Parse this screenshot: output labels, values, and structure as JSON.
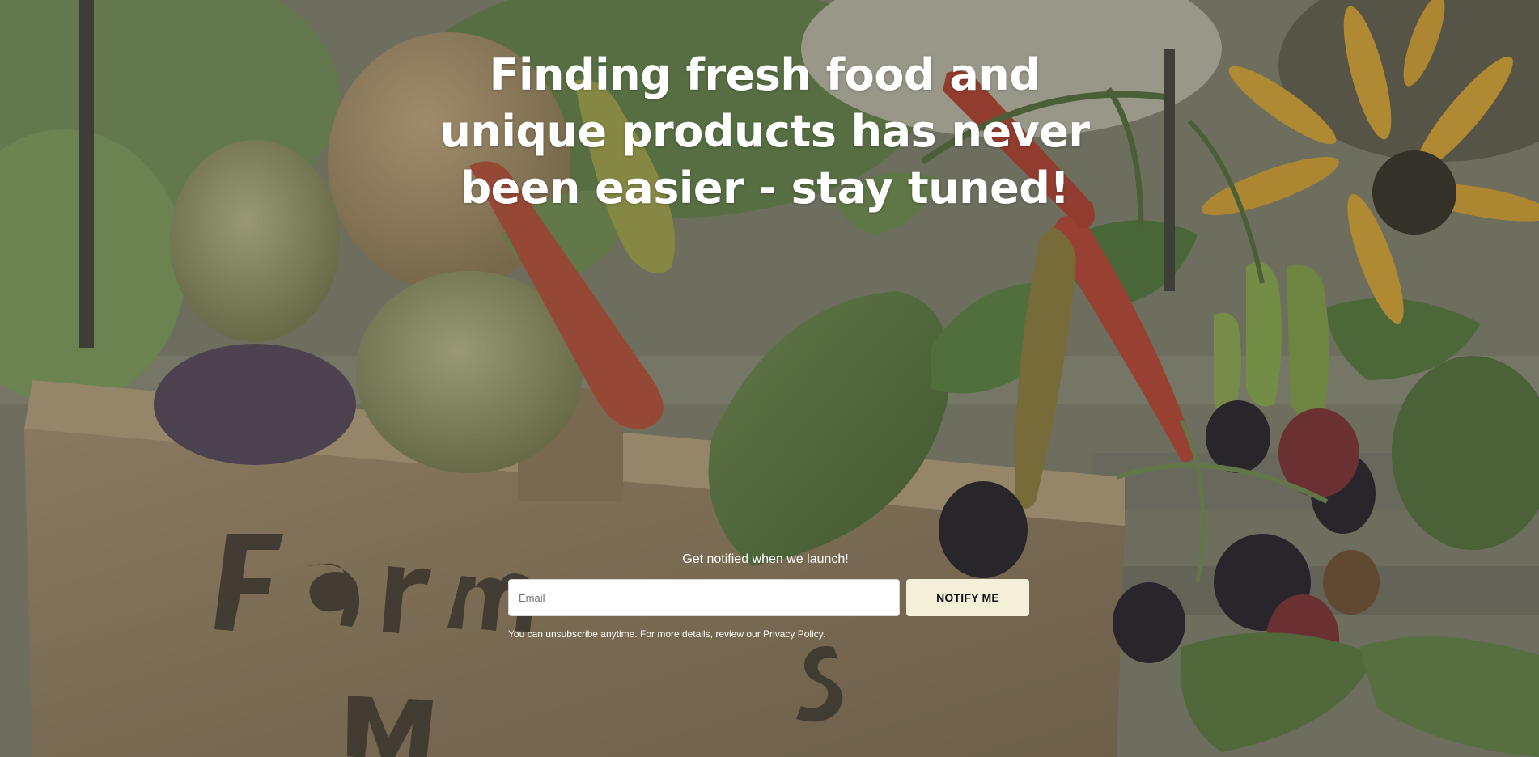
{
  "hero": {
    "headline": "Finding fresh food and unique products has never been easier - stay tuned!",
    "background_image": "farmers-market-produce-crate"
  },
  "signup": {
    "title": "Get notified when we launch!",
    "email_placeholder": "Email",
    "email_value": "",
    "button_label": "NOTIFY ME",
    "disclaimer_text": "You can unsubscribe anytime. For more details, review our ",
    "privacy_link_text": "Privacy Policy",
    "disclaimer_end": "."
  },
  "colors": {
    "headline_text": "#ffffff",
    "button_bg": "#f3efd9",
    "button_text": "#111111",
    "input_bg": "#ffffff"
  }
}
